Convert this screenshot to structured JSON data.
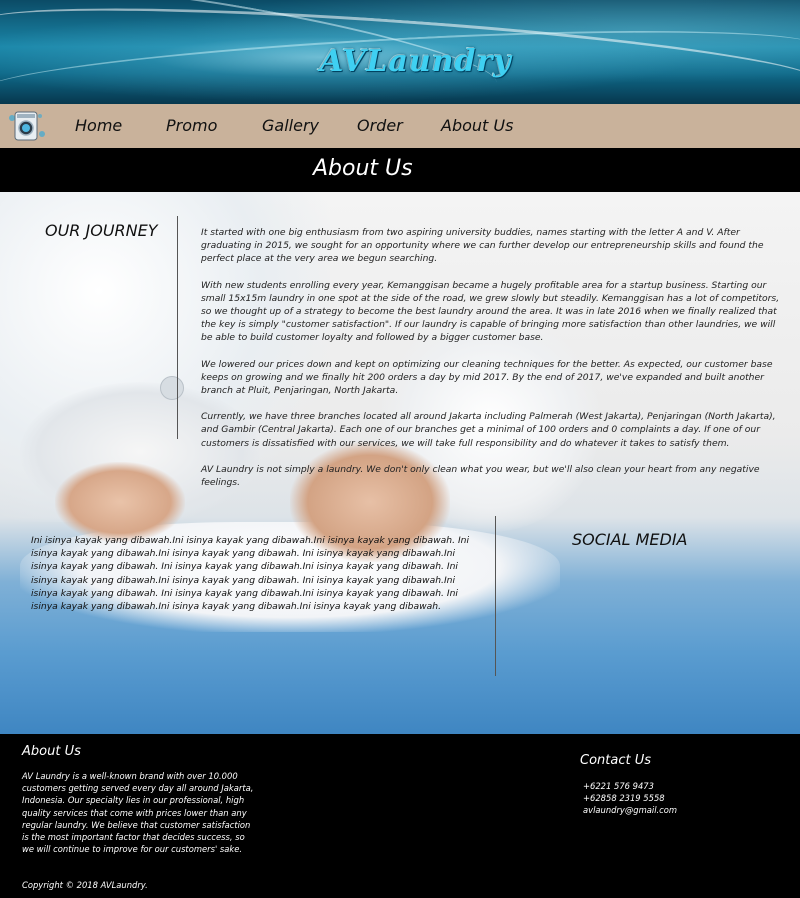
{
  "header": {
    "brand": "AVLaundry"
  },
  "nav": {
    "items": [
      "Home",
      "Promo",
      "Gallery",
      "Order",
      "About Us"
    ]
  },
  "page": {
    "title": "About Us"
  },
  "journey": {
    "heading": "OUR JOURNEY",
    "paragraphs": [
      "It started with one big enthusiasm from two aspiring university buddies, names starting with the letter A and V. After graduating in 2015, we sought for an opportunity where we can further develop our entrepreneurship skills and found the perfect place at the very area we begun searching.",
      "With new students enrolling every year, Kemanggisan became a hugely profitable area for a startup business. Starting our small 15x15m laundry in one spot at the side of the road, we grew slowly but steadily. Kemanggisan has a lot of competitors, so we thought up of a strategy to become the best laundry around the area. It was in late 2016 when we finally realized that the key is simply \"customer satisfaction\". If our laundry is capable of bringing more satisfaction than other laundries, we will be able to build customer loyalty and followed by a bigger customer base.",
      "We lowered our prices down and kept on optimizing our cleaning techniques for the better. As expected, our customer base keeps on growing and we finally hit 200 orders a day by mid 2017. By the end of 2017, we've expanded and built another branch at Pluit, Penjaringan, North Jakarta.",
      "Currently, we have three branches located all around Jakarta including Palmerah (West Jakarta), Penjaringan (North Jakarta), and Gambir (Central Jakarta). Each one of our branches get a minimal of 100 orders and 0 complaints a day. If one of our customers is dissatisfied with our services, we will take full responsibility and do whatever it takes to satisfy them.",
      "AV Laundry is not simply a laundry. We don't only clean what you wear, but we'll also clean your heart from any negative feelings."
    ]
  },
  "filler": {
    "text": "Ini isinya kayak yang dibawah.Ini isinya kayak yang dibawah.Ini isinya kayak yang dibawah. Ini isinya kayak yang dibawah.Ini isinya kayak yang dibawah. Ini isinya kayak yang dibawah.Ini isinya kayak yang dibawah. Ini isinya kayak yang dibawah.Ini isinya kayak yang dibawah. Ini isinya kayak yang dibawah.Ini isinya kayak yang dibawah. Ini isinya kayak yang dibawah.Ini isinya kayak yang dibawah. Ini isinya kayak yang dibawah.Ini isinya kayak yang dibawah. Ini isinya kayak yang dibawah.Ini isinya kayak yang dibawah.Ini isinya kayak yang dibawah."
  },
  "social": {
    "heading": "SOCIAL MEDIA"
  },
  "footer": {
    "about_title": "About Us",
    "about_text": "AV Laundry is a well-known brand with over 10.000 customers getting served every day all around Jakarta, Indonesia. Our specialty lies in our professional, high quality services that come with prices lower than any regular laundry. We believe that customer satisfaction is the most important factor that decides success, so we will continue to improve for our customers' sake.",
    "copyright": "Copyright © 2018 AVLaundry.",
    "contact_title": "Contact Us",
    "phone1": "+6221 576 9473",
    "phone2": "+62858 2319 5558",
    "email": "avlaundry@gmail.com"
  }
}
